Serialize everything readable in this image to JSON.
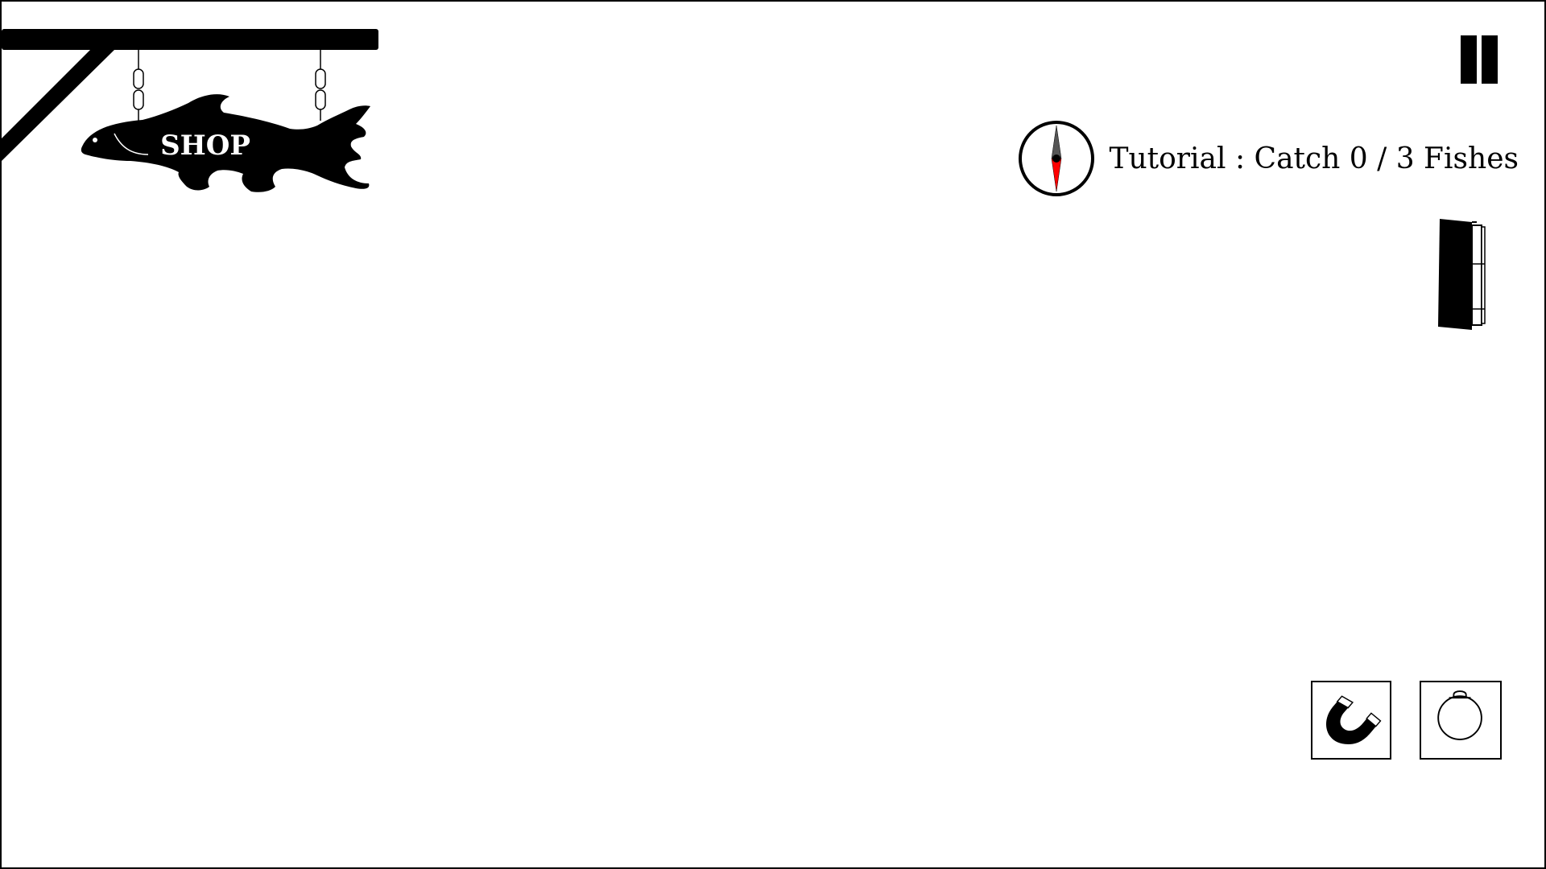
{
  "shop": {
    "label": "SHOP",
    "icon": "fish-sign-icon"
  },
  "hud": {
    "pause_icon": "pause-icon",
    "compass_icon": "compass-icon",
    "quest": {
      "label": "Tutorial",
      "separator": ":",
      "task": "Catch",
      "caught": 0,
      "target": 3,
      "unit": "Fishes",
      "text": "Tutorial : Catch 0 / 3 Fishes"
    },
    "journal_icon": "journal-book-icon"
  },
  "tools": [
    {
      "name": "magnet",
      "icon": "magnet-icon"
    },
    {
      "name": "bomb",
      "icon": "bomb-icon"
    }
  ],
  "colors": {
    "ink": "#000000",
    "background": "#ffffff",
    "compass_south": "#ff0000",
    "compass_north": "#555555"
  }
}
